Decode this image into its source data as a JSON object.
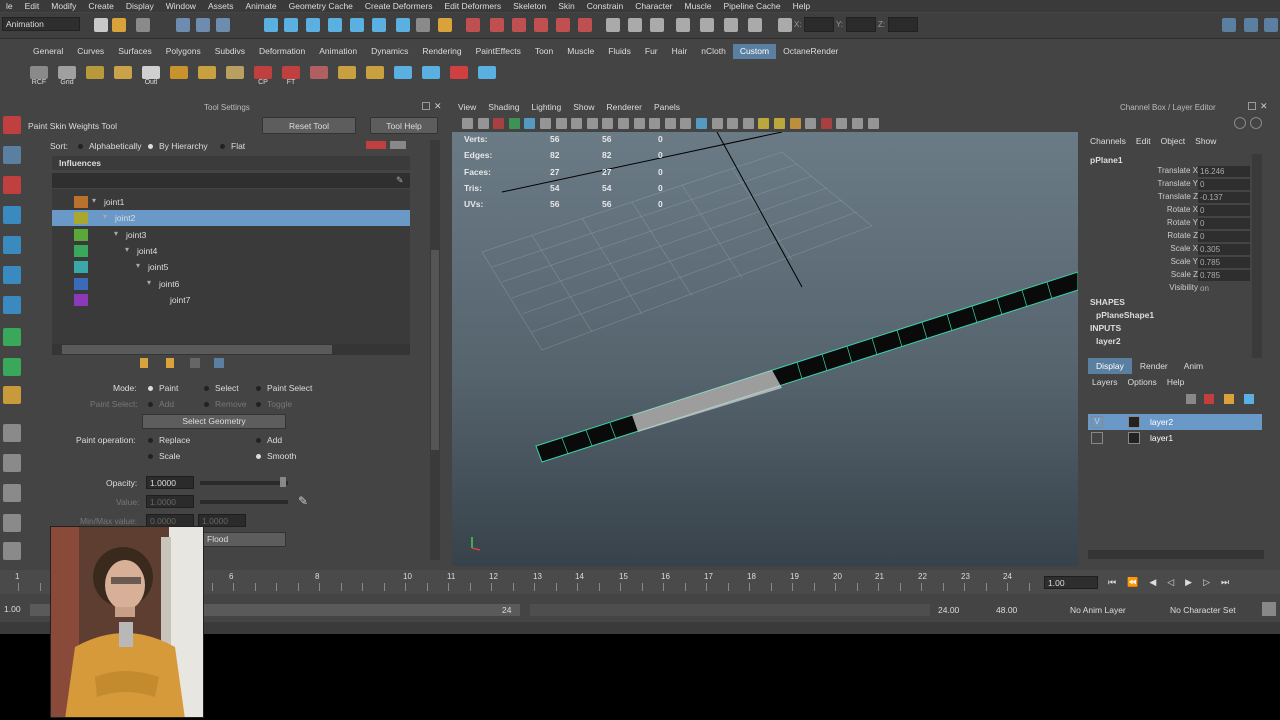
{
  "menubar": [
    "le",
    "Edit",
    "Modify",
    "Create",
    "Display",
    "Window",
    "Assets",
    "Animate",
    "Geometry Cache",
    "Create Deformers",
    "Edit Deformers",
    "Skeleton",
    "Skin",
    "Constrain",
    "Character",
    "Muscle",
    "Pipeline Cache",
    "Help"
  ],
  "status": {
    "mode": "Animation",
    "x_label": "X:",
    "y_label": "Y:",
    "z_label": "Z:"
  },
  "shelf_tabs": [
    "General",
    "Curves",
    "Surfaces",
    "Polygons",
    "Subdivs",
    "Deformation",
    "Animation",
    "Dynamics",
    "Rendering",
    "PaintEffects",
    "Toon",
    "Muscle",
    "Fluids",
    "Fur",
    "Hair",
    "nCloth",
    "Custom",
    "OctaneRender"
  ],
  "shelf_active": "Custom",
  "shelf_buttons": [
    {
      "label": "RCF",
      "color": "#8a8a8a"
    },
    {
      "label": "Grid",
      "color": "#a0a0a0"
    },
    {
      "label": "",
      "color": "#b89a3a"
    },
    {
      "label": "",
      "color": "#c9a24a"
    },
    {
      "label": "Outl",
      "color": "#d0d0d0"
    },
    {
      "label": "",
      "color": "#c8932c"
    },
    {
      "label": "",
      "color": "#c8a040"
    },
    {
      "label": "",
      "color": "#b8a060"
    },
    {
      "label": "CP",
      "color": "#c04040"
    },
    {
      "label": "FT",
      "color": "#c04040"
    },
    {
      "label": "",
      "color": "#b06060"
    },
    {
      "label": "",
      "color": "#c8a040"
    },
    {
      "label": "",
      "color": "#c8a040"
    },
    {
      "label": "",
      "color": "#5ab0e0"
    },
    {
      "label": "",
      "color": "#5ab0e0"
    },
    {
      "label": "",
      "color": "#d04040"
    },
    {
      "label": "",
      "color": "#5ab0e0"
    }
  ],
  "tool_settings": {
    "panel_title": "Tool Settings",
    "tool_name": "Paint Skin Weights Tool",
    "reset_button": "Reset Tool",
    "help_button": "Tool Help",
    "sort_label": "Sort:",
    "sort_options": [
      "Alphabetically",
      "By Hierarchy",
      "Flat"
    ],
    "sort_selected": "By Hierarchy",
    "influences_header": "Influences",
    "joints": [
      {
        "name": "joint1",
        "color": "#b8722e",
        "depth": 0,
        "selected": false
      },
      {
        "name": "joint2",
        "color": "#a8a830",
        "depth": 1,
        "selected": true
      },
      {
        "name": "joint3",
        "color": "#5aa83a",
        "depth": 2,
        "selected": false
      },
      {
        "name": "joint4",
        "color": "#3aa85a",
        "depth": 3,
        "selected": false
      },
      {
        "name": "joint5",
        "color": "#3aa8a8",
        "depth": 4,
        "selected": false
      },
      {
        "name": "joint6",
        "color": "#3a6ab8",
        "depth": 5,
        "selected": false
      },
      {
        "name": "joint7",
        "color": "#8a3ab8",
        "depth": 6,
        "selected": false
      }
    ],
    "mode_label": "Mode:",
    "mode_options": [
      "Paint",
      "Select",
      "Paint Select"
    ],
    "mode_selected": "Paint",
    "paint_select_label": "Paint Select:",
    "paint_select_options": [
      "Add",
      "Remove",
      "Toggle"
    ],
    "select_geometry_button": "Select Geometry",
    "paint_operation_label": "Paint operation:",
    "paint_ops": [
      "Replace",
      "Add",
      "Scale",
      "Smooth"
    ],
    "paint_op_selected": "Smooth",
    "opacity_label": "Opacity:",
    "opacity_value": "1.0000",
    "value_label": "Value:",
    "value_value": "1.0000",
    "minmax_label": "Min/Max value:",
    "min_value": "0.0000",
    "max_value": "1.0000",
    "flood_button": "Flood"
  },
  "viewport": {
    "menu": [
      "View",
      "Shading",
      "Lighting",
      "Show",
      "Renderer",
      "Panels"
    ],
    "hud_rows": [
      {
        "label": "Verts:",
        "a": "56",
        "b": "56",
        "c": "0"
      },
      {
        "label": "Edges:",
        "a": "82",
        "b": "82",
        "c": "0"
      },
      {
        "label": "Faces:",
        "a": "27",
        "b": "27",
        "c": "0"
      },
      {
        "label": "Tris:",
        "a": "54",
        "b": "54",
        "c": "0"
      },
      {
        "label": "UVs:",
        "a": "56",
        "b": "56",
        "c": "0"
      }
    ]
  },
  "channel_box": {
    "panel_title": "Channel Box / Layer Editor",
    "menu": [
      "Channels",
      "Edit",
      "Object",
      "Show"
    ],
    "object_name": "pPlane1",
    "attributes": [
      {
        "label": "Translate X",
        "value": "16.246"
      },
      {
        "label": "Translate Y",
        "value": "0"
      },
      {
        "label": "Translate Z",
        "value": "-0.137"
      },
      {
        "label": "Rotate X",
        "value": "0"
      },
      {
        "label": "Rotate Y",
        "value": "0"
      },
      {
        "label": "Rotate Z",
        "value": "0"
      },
      {
        "label": "Scale X",
        "value": "0.305"
      },
      {
        "label": "Scale Y",
        "value": "0.785"
      },
      {
        "label": "Scale Z",
        "value": "0.785"
      },
      {
        "label": "Visibility",
        "value": "on"
      }
    ],
    "shapes_label": "SHAPES",
    "shape_name": "pPlaneShape1",
    "inputs_label": "INPUTS",
    "input_name": "layer2",
    "layer_tabs": [
      "Display",
      "Render",
      "Anim"
    ],
    "layer_tab_active": "Display",
    "layer_menu": [
      "Layers",
      "Options",
      "Help"
    ],
    "layers": [
      {
        "name": "layer2",
        "vis": "V",
        "selected": true
      },
      {
        "name": "layer1",
        "vis": "",
        "selected": false
      }
    ]
  },
  "timeline": {
    "ticks": [
      "1",
      "6",
      "8",
      "10",
      "11",
      "12",
      "13",
      "14",
      "15",
      "16",
      "17",
      "18",
      "19",
      "20",
      "21",
      "22",
      "23",
      "24"
    ],
    "current_frame": "1.00",
    "range_start": "1.00",
    "range_mid": "24",
    "range_end_1": "24.00",
    "range_end_2": "48.00",
    "anim_layer": "No Anim Layer",
    "character_set": "No Character Set"
  }
}
